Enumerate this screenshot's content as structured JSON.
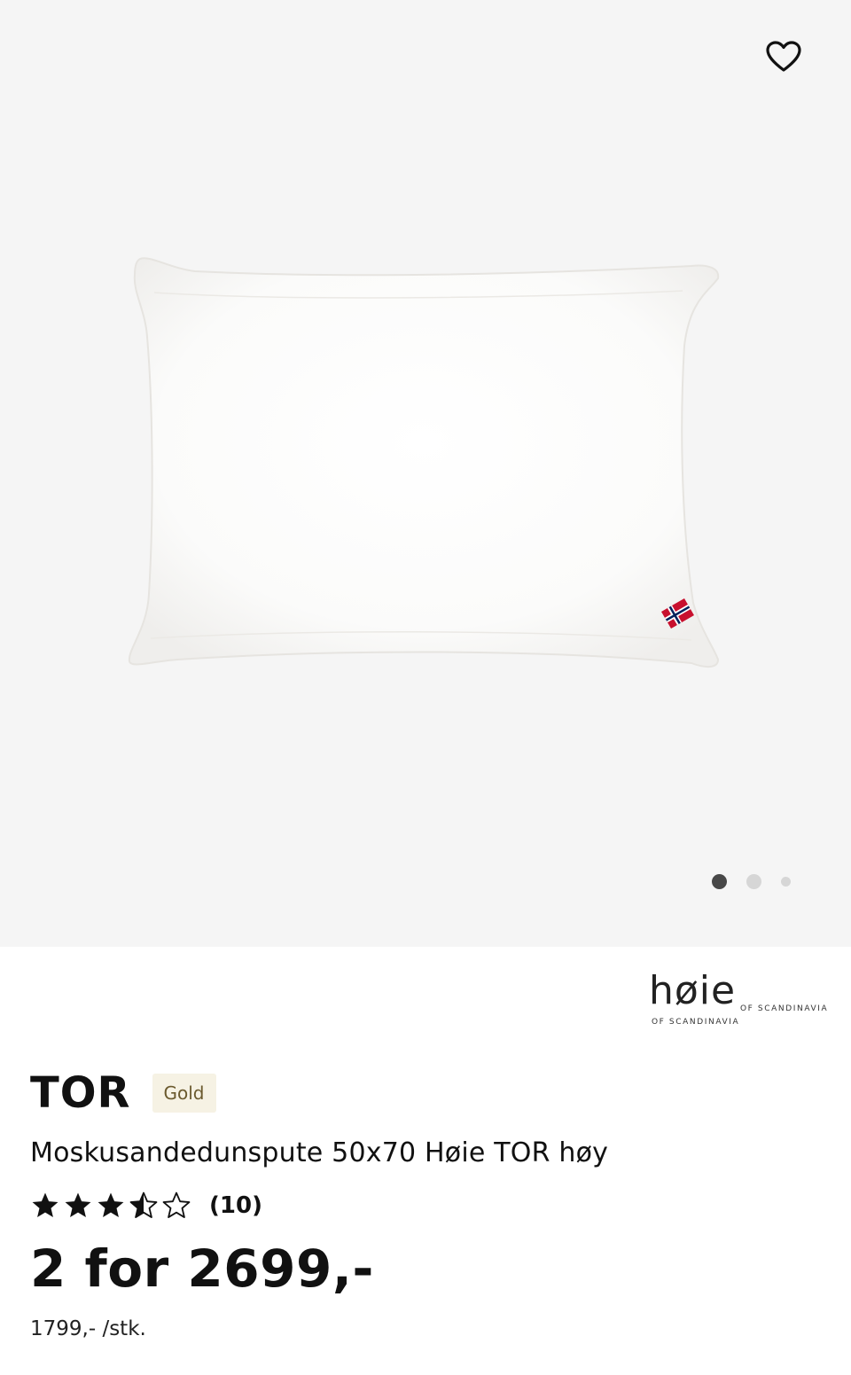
{
  "gallery": {
    "image_count": 3,
    "active_index": 0,
    "favorite_icon": "heart-outline-icon",
    "background": "#f5f5f5"
  },
  "brand": {
    "name": "høie",
    "tagline": "OF SCANDINAVIA"
  },
  "product": {
    "name": "TOR",
    "badge": "Gold",
    "description": "Moskusandedunspute 50x70 Høie TOR høy",
    "rating": {
      "value": 3.5,
      "max": 5,
      "count_label": "(10)"
    },
    "price": "2 for 2699,-",
    "unit_price": "1799,- /stk."
  },
  "colors": {
    "text": "#111111",
    "badge_bg": "#f6f2e4",
    "badge_text": "#6b5a2e",
    "dot_active": "#484848",
    "dot_inactive": "#d6d6d6"
  }
}
